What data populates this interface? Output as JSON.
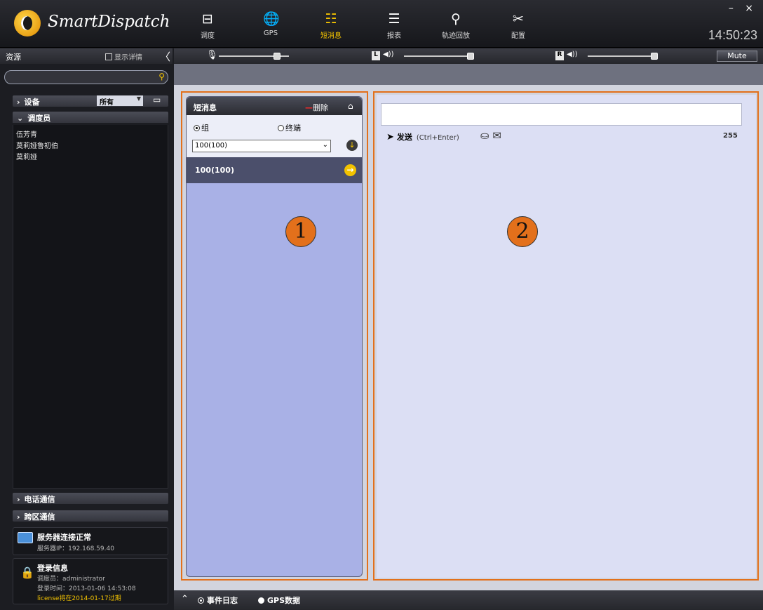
{
  "app": {
    "title": "SmartDispatch",
    "window_controls": "– ×",
    "clock": "14:50:23"
  },
  "nav": [
    {
      "label": "调度",
      "icon": "dispatch-icon",
      "glyph": "⊟"
    },
    {
      "label": "GPS",
      "icon": "globe-icon",
      "glyph": "🌐"
    },
    {
      "label": "短消息",
      "icon": "message-icon",
      "glyph": "☷",
      "active": true
    },
    {
      "label": "报表",
      "icon": "report-icon",
      "glyph": "☰"
    },
    {
      "label": "轨迹回放",
      "icon": "track-playback-icon",
      "glyph": "⚲"
    },
    {
      "label": "配置",
      "icon": "tools-icon",
      "glyph": "✂"
    }
  ],
  "sidebar": {
    "title": "资源",
    "show_details_label": "显示详情",
    "collapse_glyph": "〈",
    "search_placeholder": "",
    "groups": {
      "devices": {
        "label": "设备",
        "filter": "所有"
      },
      "dispatchers": {
        "label": "调度员",
        "members": [
          "伍芳青",
          "莫莉娅鲁初伯",
          "莫莉娅"
        ]
      },
      "phone": {
        "label": "电话通信"
      },
      "cross_region": {
        "label": "跨区通信"
      }
    },
    "server_status": {
      "title": "服务器连接正常",
      "ip_label": "服务器IP：",
      "ip": "192.168.59.40"
    },
    "login_info": {
      "title": "登录信息",
      "dispatcher_label": "调度员：",
      "dispatcher": "administrator",
      "login_time_label": "登录时间：",
      "login_time": "2013-01-06 14:53:08",
      "license": "license将在2014-01-17过期"
    }
  },
  "audio": {
    "mic_glyph": "🎙",
    "left_label": "L",
    "right_label": "R",
    "speaker_glyph": "◀))",
    "mute_label": "Mute"
  },
  "panel1": {
    "title": "短消息",
    "delete_label": "删除",
    "radio_group": "组",
    "radio_terminal": "终端",
    "group_select": "100(100)",
    "items": [
      {
        "label": "100(100)"
      }
    ],
    "marker": "1"
  },
  "panel2": {
    "send_label": "发送",
    "send_hint": "(Ctrl+Enter)",
    "char_count": "255",
    "marker": "2"
  },
  "bottombar": {
    "event_log": "事件日志",
    "gps_data": "GPS数据"
  },
  "colors": {
    "accent": "#f2c200",
    "highlight_frame": "#e3701b",
    "panel1_bg": "#a9b1e6",
    "panel2_bg": "#dcdff4"
  }
}
